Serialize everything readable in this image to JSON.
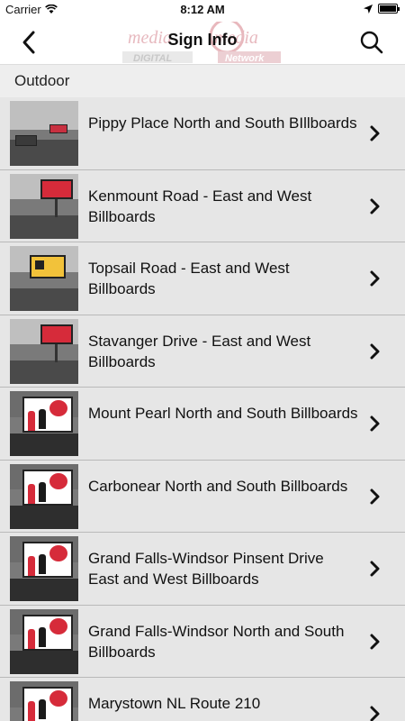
{
  "status_bar": {
    "carrier": "Carrier",
    "time": "8:12 AM"
  },
  "nav": {
    "title": "Sign Info",
    "logo_text_top": "mediamedia",
    "logo_text_left": "DIGITAL",
    "logo_text_right": "Network"
  },
  "section": {
    "title": "Outdoor"
  },
  "rows": [
    {
      "label": "Pippy Place North and South BIllboards",
      "thumb": "street-scene"
    },
    {
      "label": "Kenmount Road - East and West Billboards",
      "thumb": "red-billboard"
    },
    {
      "label": "Topsail Road - East and West Billboards",
      "thumb": "yellow-sign"
    },
    {
      "label": "Stavanger Drive - East and West Billboards",
      "thumb": "red-billboard"
    },
    {
      "label": "Mount Pearl North and South Billboards",
      "thumb": "people-billboard"
    },
    {
      "label": "Carbonear North and South Billboards",
      "thumb": "people-billboard"
    },
    {
      "label": "Grand Falls-Windsor Pinsent Drive East and West Billboards",
      "thumb": "people-billboard"
    },
    {
      "label": "Grand Falls-Windsor North and South Billboards",
      "thumb": "people-billboard"
    },
    {
      "label": "Marystown NL Route 210",
      "thumb": "people-billboard"
    }
  ],
  "colors": {
    "accent_red": "#d62b3a",
    "row_background": "#e6e6e6",
    "section_background": "#eeeeee"
  }
}
